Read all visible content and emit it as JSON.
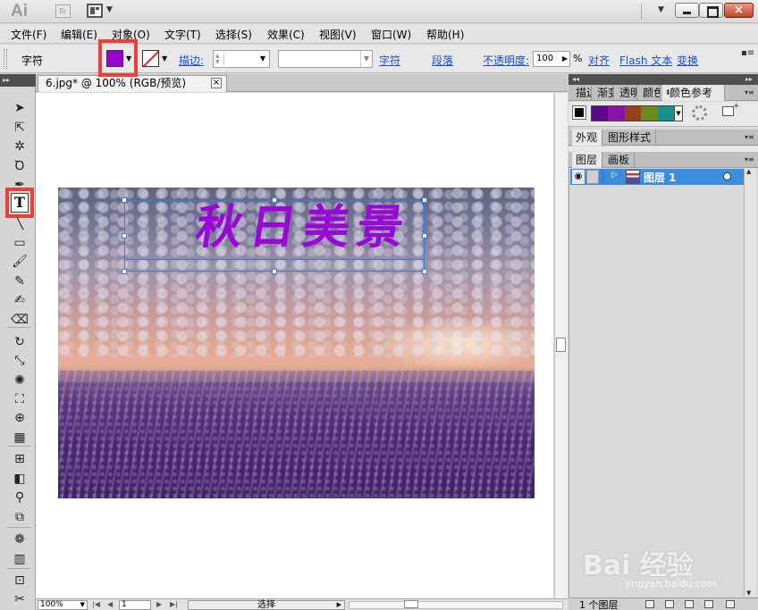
{
  "app": {
    "logo": "Ai",
    "bridge_label": "Br",
    "window_buttons": {
      "minimize": "minimize-icon",
      "maximize": "maximize-icon",
      "close": "×"
    }
  },
  "menu": {
    "items": [
      "文件(F)",
      "编辑(E)",
      "对象(O)",
      "文字(T)",
      "选择(S)",
      "效果(C)",
      "视图(V)",
      "窗口(W)",
      "帮助(H)"
    ]
  },
  "control_bar": {
    "char_label": "字符",
    "fill_color": "#9900cc",
    "stroke_label": "描边:",
    "stroke_weight": "",
    "font_family": "",
    "char_link": "字符",
    "para_link": "段落",
    "opacity_label": "不透明度:",
    "opacity_value": "100",
    "opacity_unit": "%",
    "align_link": "对齐",
    "flash_link": "Flash 文本",
    "transform_link": "变换"
  },
  "document": {
    "tab_title": "6.jpg* @ 100% (RGB/预览)",
    "text_frame_content": "秋日美景"
  },
  "status_bar": {
    "zoom": "100%",
    "page": "1",
    "tool_status": "选择"
  },
  "panels": {
    "top_tabs": [
      "描边",
      "渐变",
      "透明",
      "颜色",
      "颜色参考"
    ],
    "guide_colors": [
      "#5a0a8a",
      "#8a10a8",
      "#9a3f1a",
      "#6d8a1a",
      "#15908a"
    ],
    "middle_tabs": [
      "外观",
      "图形样式"
    ],
    "layers_tabs": [
      "图层",
      "画板"
    ],
    "layers": [
      {
        "name": "图层 1",
        "color": "#3a7bd5"
      }
    ],
    "layer_count": "1 个图层"
  },
  "watermark": {
    "text": "Bai 经验",
    "url": "jingyan.baidu.com"
  }
}
